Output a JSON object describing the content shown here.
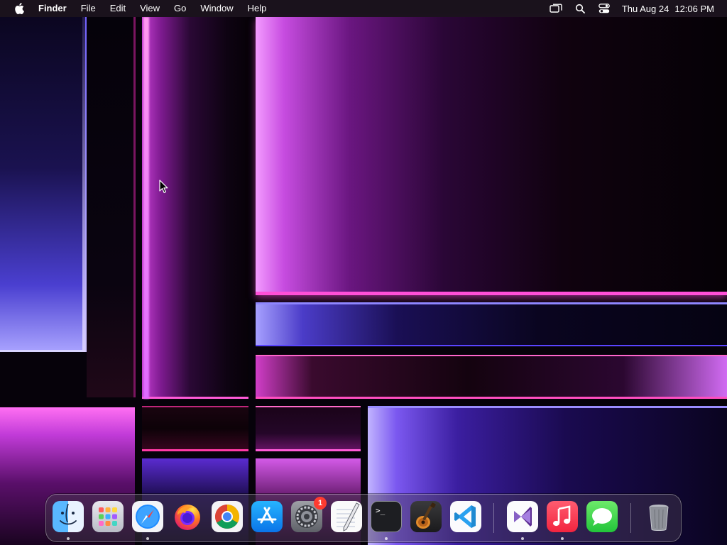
{
  "menubar": {
    "app_name": "Finder",
    "items": [
      "File",
      "Edit",
      "View",
      "Go",
      "Window",
      "Help"
    ],
    "status_icons": [
      "screen-mirroring-icon",
      "spotlight-search-icon",
      "control-center-icon"
    ],
    "date": "Thu Aug 24",
    "time": "12:06 PM"
  },
  "dock": {
    "apps": [
      {
        "name": "Finder",
        "icon": "finder-icon",
        "running": true
      },
      {
        "name": "Launchpad",
        "icon": "launchpad-icon",
        "running": false
      },
      {
        "name": "Safari",
        "icon": "safari-icon",
        "running": true
      },
      {
        "name": "Firefox",
        "icon": "firefox-icon",
        "running": false
      },
      {
        "name": "Google Chrome",
        "icon": "chrome-icon",
        "running": false
      },
      {
        "name": "App Store",
        "icon": "app-store-icon",
        "running": false
      },
      {
        "name": "System Settings",
        "icon": "system-settings-icon",
        "running": false,
        "badge": "1"
      },
      {
        "name": "TextEdit",
        "icon": "textedit-icon",
        "running": false
      },
      {
        "name": "Terminal",
        "icon": "terminal-icon",
        "running": true
      },
      {
        "name": "GarageBand",
        "icon": "garageband-icon",
        "running": false
      },
      {
        "name": "Visual Studio Code",
        "icon": "vscode-icon",
        "running": false
      },
      {
        "name": "Visual Studio",
        "icon": "visual-studio-icon",
        "running": true
      },
      {
        "name": "Music",
        "icon": "music-icon",
        "running": true
      },
      {
        "name": "Messages",
        "icon": "messages-icon",
        "running": false
      },
      {
        "name": "Trash",
        "icon": "trash-icon",
        "running": false
      }
    ],
    "terminal_prompt": ">_"
  },
  "colors": {
    "menubar_bg": "#1c141e",
    "badge_red": "#ff3b30",
    "wallpaper_pink": "#ff4fd8",
    "wallpaper_blue": "#5a44ff"
  }
}
